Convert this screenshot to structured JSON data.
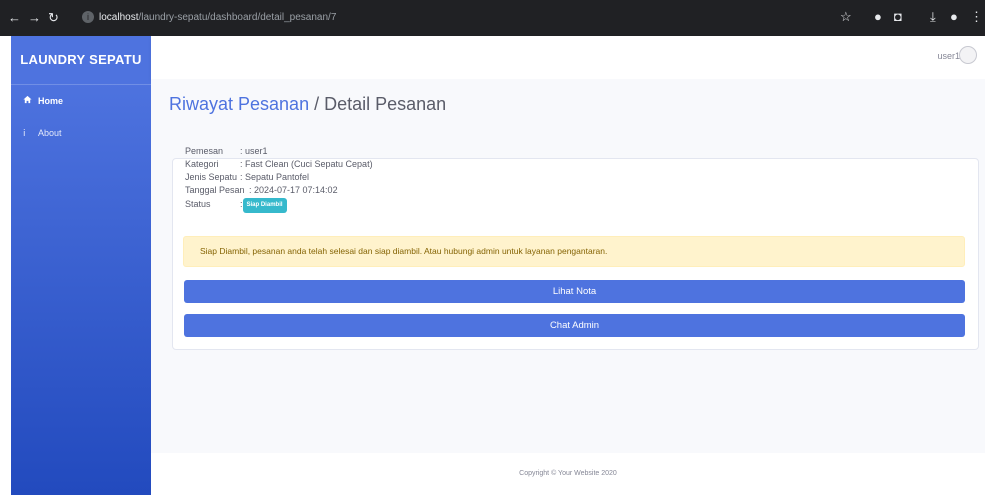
{
  "browser": {
    "url_host": "localhost",
    "url_path": "/laundry-sepatu/dashboard/detail_pesanan/7"
  },
  "sidebar": {
    "brand": "LAUNDRY SEPATU",
    "items": [
      {
        "label": "Home",
        "icon": "home-icon",
        "active": true
      },
      {
        "label": "About",
        "icon": "info-icon",
        "active": false
      }
    ]
  },
  "topbar": {
    "user": "user1"
  },
  "page": {
    "crumb": "Riwayat Pesanan",
    "separator": " / ",
    "title": "Detail Pesanan"
  },
  "detail": {
    "rows": [
      {
        "label": "Pemesan",
        "value": ": user1"
      },
      {
        "label": "Kategori",
        "value": ": Fast Clean (Cuci Sepatu Cepat)"
      },
      {
        "label": "Jenis Sepatu",
        "value": ": Sepatu Pantofel"
      },
      {
        "label": "Tanggal Pesan",
        "value": ": 2024-07-17 07:14:02"
      }
    ],
    "status_label": "Status",
    "status_prefix": ": ",
    "status_badge": "Siap Diambil"
  },
  "alert": {
    "text": "Siap Diambil, pesanan anda telah selesai dan siap diambil. Atau hubungi admin untuk layanan pengantaran."
  },
  "buttons": {
    "nota": "Lihat Nota",
    "chat": "Chat Admin"
  },
  "footer": {
    "text": "Copyright © Your Website 2020"
  },
  "colors": {
    "primary": "#4e73df",
    "info": "#36b9cc",
    "warning_bg": "#fff3cd",
    "warning_text": "#856404"
  }
}
